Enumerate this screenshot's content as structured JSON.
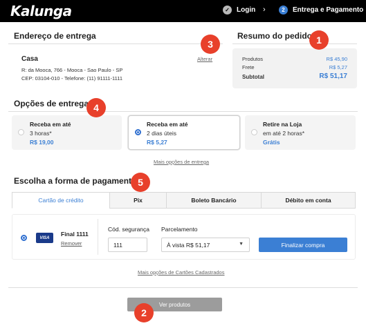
{
  "header": {
    "logo": "Kalunga",
    "steps": [
      {
        "label": "Login",
        "icon": "check-icon"
      },
      {
        "number": "2",
        "label": "Entrega e Pagamento"
      }
    ],
    "arrow": "›"
  },
  "address": {
    "title": "Endereço de entrega",
    "name": "Casa",
    "line1": "R: da Mooca, 766 - Mooca -  Sao Paulo - SP",
    "line2": "CEP: 03104-010 -  Telefone: (11) 91111-1111",
    "alterar": "Alterar"
  },
  "summary": {
    "title": "Resumo do pedido",
    "rows": [
      {
        "label": "Produtos",
        "value": "R$ 45,90"
      },
      {
        "label": "Frete",
        "value": "R$ 5,27"
      },
      {
        "label": "Subtotal",
        "value": "R$ 51,17"
      }
    ]
  },
  "delivery": {
    "title": "Opções de entrega",
    "options": [
      {
        "line1": "Receba em até",
        "line2": "3 horas*",
        "price": "R$ 19,00",
        "selected": false
      },
      {
        "line1": "Receba em até",
        "line2": "2 dias úteis",
        "price": "R$ 5,27",
        "selected": true
      },
      {
        "line1": "Retire na Loja",
        "line2": "em até 2 horas*",
        "price": "Grátis",
        "selected": false
      }
    ],
    "more": "Mais opções de entrega"
  },
  "payment": {
    "title": "Escolha a forma de pagamento",
    "tabs": [
      "Cartão de crédito",
      "Pix",
      "Boleto Bancário",
      "Débito em conta"
    ],
    "card": {
      "brand": "VISA",
      "final": "Final 1111",
      "remover": "Remover"
    },
    "security_label": "Cód. segurança",
    "security_value": "111",
    "installments_label": "Parcelamento",
    "installments_value": "À vista R$ 51,17",
    "submit": "Finalizar compra",
    "more_cards": "Mais opções de Cartões Cadastrados"
  },
  "footer": {
    "ver_produtos": "Ver produtos"
  },
  "callouts": [
    "1",
    "2",
    "3",
    "4",
    "5"
  ],
  "colors": {
    "accent": "#3b7fd4",
    "callout": "#e8402b",
    "header_bg": "#000000"
  }
}
